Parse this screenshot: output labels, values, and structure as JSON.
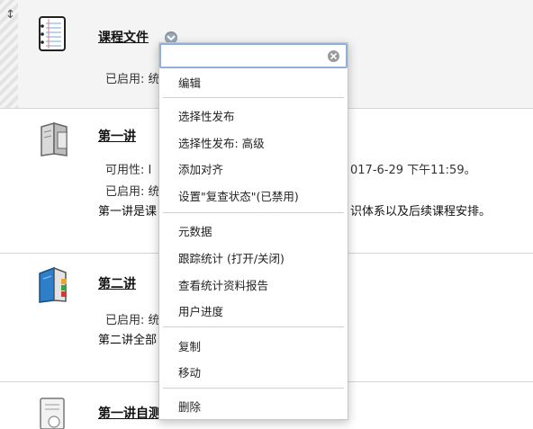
{
  "items": [
    {
      "title": "课程文件",
      "lines": [
        "已启用:  统"
      ]
    },
    {
      "title": "第一讲",
      "lines": [
        "可用性:  I",
        "已启用:  统",
        "第一讲是课"
      ],
      "overflow_right": [
        "017-6-29 下午11:59。",
        "",
        "识体系以及后续课程安排。"
      ]
    },
    {
      "title": "第二讲",
      "lines": [
        "已启用:  统",
        "第二讲全部"
      ]
    },
    {
      "title": "第一讲自测"
    }
  ],
  "menu": {
    "search_value": "",
    "groups": [
      [
        "编辑"
      ],
      [
        "选择性发布",
        "选择性发布: 高级",
        "添加对齐",
        "设置\"复查状态\"(已禁用)"
      ],
      [
        "元数据",
        "跟踪统计 (打开/关闭)",
        "查看统计资料报告",
        "用户进度"
      ],
      [
        "复制",
        "移动"
      ],
      [
        "删除"
      ]
    ]
  },
  "colors": {
    "highlight_row": "#f4f4f4",
    "search_border": "#8fb1d9",
    "trigger": "#9aa8b8"
  },
  "icons": {
    "row1": "notebook-icon",
    "row2": "book-icon",
    "row3": "colored-book-icon",
    "row4": "quiz-document-icon"
  }
}
